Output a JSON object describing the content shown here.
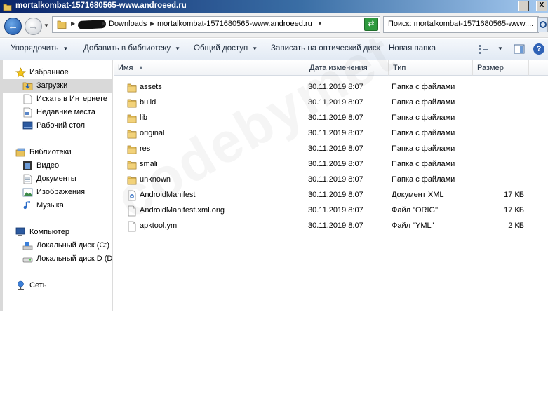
{
  "window": {
    "title": "mortalkombat-1571680565-www.androeed.ru",
    "minimize_label": "_",
    "close_label": "X"
  },
  "address": {
    "segments": [
      "Downloads",
      "mortalkombat-1571680565-www.androeed.ru"
    ],
    "search_value": "Поиск: mortalkombat-1571680565-www...."
  },
  "toolbar": {
    "organize": "Упорядочить",
    "add_to_library": "Добавить в библиотеку",
    "share": "Общий доступ",
    "burn": "Записать на оптический диск",
    "new_folder": "Новая папка"
  },
  "nav": {
    "favorites": "Избранное",
    "downloads": "Загрузки",
    "search_internet": "Искать в Интернете",
    "recent": "Недавние места",
    "desktop": "Рабочий стол",
    "libraries": "Библиотеки",
    "video": "Видео",
    "documents": "Документы",
    "images": "Изображения",
    "music": "Музыка",
    "computer": "Компьютер",
    "disk_c": "Локальный диск (C:)",
    "disk_d": "Локальный диск D (D",
    "network": "Сеть"
  },
  "columns": {
    "name": "Имя",
    "modified": "Дата изменения",
    "type": "Тип",
    "size": "Размер"
  },
  "files": [
    {
      "name": "assets",
      "modified": "30.11.2019 8:07",
      "type": "Папка с файлами",
      "size": "",
      "icon": "folder-icon"
    },
    {
      "name": "build",
      "modified": "30.11.2019 8:07",
      "type": "Папка с файлами",
      "size": "",
      "icon": "folder-icon"
    },
    {
      "name": "lib",
      "modified": "30.11.2019 8:07",
      "type": "Папка с файлами",
      "size": "",
      "icon": "folder-icon"
    },
    {
      "name": "original",
      "modified": "30.11.2019 8:07",
      "type": "Папка с файлами",
      "size": "",
      "icon": "folder-icon"
    },
    {
      "name": "res",
      "modified": "30.11.2019 8:07",
      "type": "Папка с файлами",
      "size": "",
      "icon": "folder-icon"
    },
    {
      "name": "smali",
      "modified": "30.11.2019 8:07",
      "type": "Папка с файлами",
      "size": "",
      "icon": "folder-icon"
    },
    {
      "name": "unknown",
      "modified": "30.11.2019 8:07",
      "type": "Папка с файлами",
      "size": "",
      "icon": "folder-icon"
    },
    {
      "name": "AndroidManifest",
      "modified": "30.11.2019 8:07",
      "type": "Документ XML",
      "size": "17 КБ",
      "icon": "xml-file-icon"
    },
    {
      "name": "AndroidManifest.xml.orig",
      "modified": "30.11.2019 8:07",
      "type": "Файл \"ORIG\"",
      "size": "17 КБ",
      "icon": "file-icon"
    },
    {
      "name": "apktool.yml",
      "modified": "30.11.2019 8:07",
      "type": "Файл \"YML\"",
      "size": "2 КБ",
      "icon": "file-icon"
    }
  ],
  "watermark": "codebymet",
  "colors": {
    "titlebar": "#0a246a",
    "selected_nav": "#d9d9d9",
    "folder": "#e8c25a"
  }
}
